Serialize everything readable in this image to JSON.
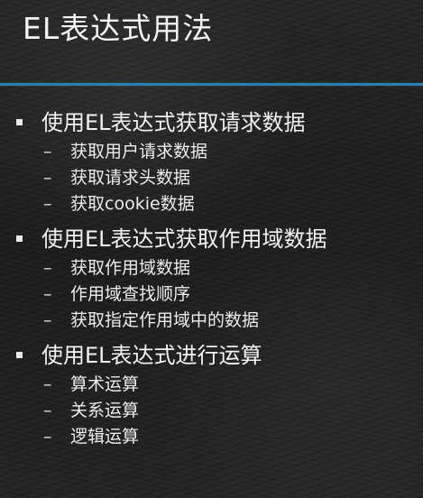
{
  "title": "EL表达式用法",
  "sections": [
    {
      "heading": "使用EL表达式获取请求数据",
      "items": [
        "获取用户请求数据",
        "获取请求头数据",
        "获取cookie数据"
      ]
    },
    {
      "heading": "使用EL表达式获取作用域数据",
      "items": [
        "获取作用域数据",
        "作用域查找顺序",
        "获取指定作用域中的数据"
      ]
    },
    {
      "heading": "使用EL表达式进行运算",
      "items": [
        "算术运算",
        "关系运算",
        "逻辑运算"
      ]
    }
  ],
  "colors": {
    "background": "#222222",
    "text": "#f2f2f2",
    "accent_rule": "#2b7fb0"
  }
}
